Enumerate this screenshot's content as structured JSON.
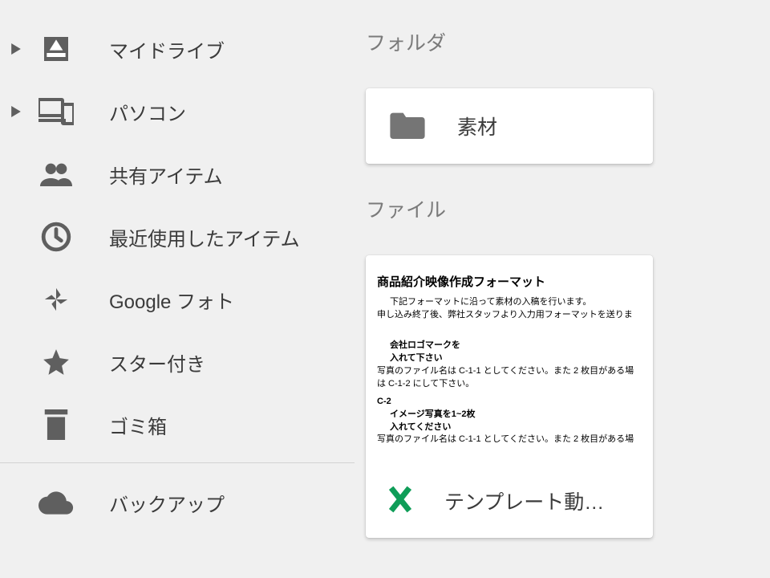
{
  "sidebar": {
    "items": [
      {
        "label": "マイドライブ"
      },
      {
        "label": "パソコン"
      },
      {
        "label": "共有アイテム"
      },
      {
        "label": "最近使用したアイテム"
      },
      {
        "label": "Google フォト"
      },
      {
        "label": "スター付き"
      },
      {
        "label": "ゴミ箱"
      },
      {
        "label": "バックアップ"
      }
    ]
  },
  "main": {
    "folders_heading": "フォルダ",
    "files_heading": "ファイル",
    "folder_name": "素材",
    "file_name": "テンプレート動…",
    "doc": {
      "title": "商品紹介映像作成フォーマット",
      "line1": "下記フォーマットに沿って素材の入稿を行います。",
      "line2": "申し込み終了後、弊社スタッフより入力用フォーマットを送りま",
      "line3a": "会社ロゴマークを",
      "line3b": "入れて下さい",
      "line4": "写真のファイル名は C-1-1 としてください。また 2 枚目がある場",
      "line5": "は C-1-2 にして下さい。",
      "line6": "C-2",
      "line7a": "イメージ写真を1~2枚",
      "line7b": "入れてください",
      "line8": "写真のファイル名は C-1-1 としてください。また 2 枚目がある場"
    }
  }
}
